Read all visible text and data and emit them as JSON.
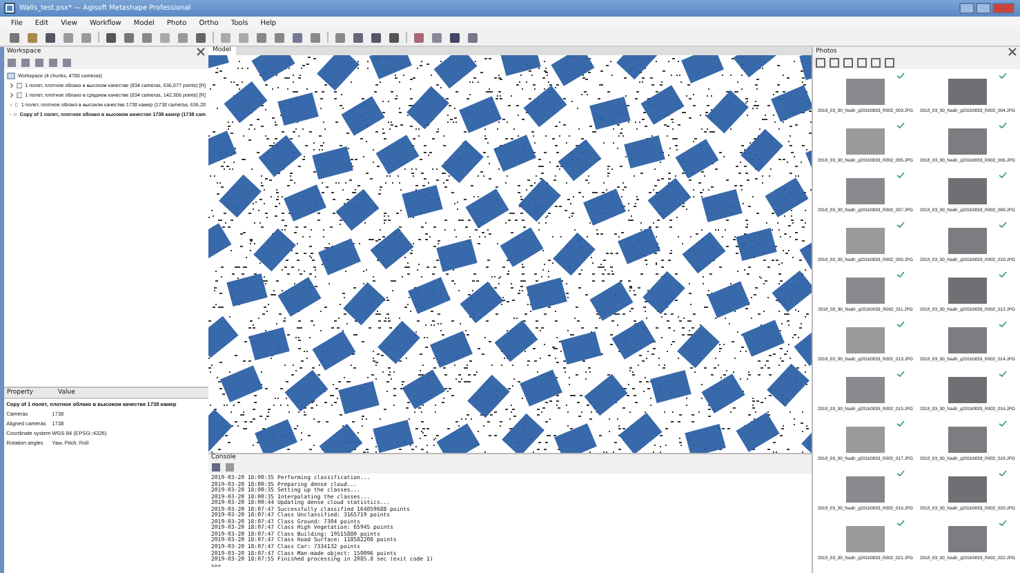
{
  "window": {
    "title": "Walls_test.psx* — Agisoft Metashape Professional"
  },
  "menu": [
    "File",
    "Edit",
    "View",
    "Workflow",
    "Model",
    "Photo",
    "Ortho",
    "Tools",
    "Help"
  ],
  "workspace": {
    "title": "Workspace",
    "root": "Workspace (4 chunks, 4780 cameras)",
    "chunks": [
      {
        "label": "1 полет, плотное облако в высоком качестве (834 cameras, 636,077 points) [R]",
        "active": false
      },
      {
        "label": "1 полет, плотное облако в среднем качестве (834 cameras, 142,306 points) [R]",
        "active": false
      },
      {
        "label": "1 полет, плотное облако в высоком качестве 1738 камер (1738 cameras, 636,28",
        "active": false
      },
      {
        "label": "Copy of 1 полет, плотное облако в высоком качестве 1738 камер (1738 cam",
        "active": true
      }
    ]
  },
  "properties": {
    "columns": [
      "Property",
      "Value"
    ],
    "heading": "Copy of 1 полет, плотное облако в высоком качестве 1738 камер",
    "rows": [
      [
        "Cameras",
        "1738"
      ],
      [
        "Aligned cameras",
        "1738"
      ],
      [
        "Coordinate system",
        "WGS 84 (EPSG::4326)"
      ],
      [
        "Rotation angles",
        "Yaw, Pitch, Roll"
      ]
    ]
  },
  "model": {
    "title": "Model"
  },
  "console": {
    "title": "Console",
    "lines": [
      "2019-03-20 18:00:35 Performing classification...",
      "2019-03-20 18:00:35 Preparing dense cloud...",
      "2019-03-20 18:00:35 Setting up the classes...",
      "2019-03-20 18:00:35 Interpolating the classes...",
      "2019-03-20 18:00:44 Updating dense cloud statistics...",
      "2019-03-20 18:07:47 Successfully classified 164859688 points",
      "2019-03-20 18:07:47 Class Unclassified: 3165719 points",
      "2019-03-20 18:07:47 Class Ground: 7304 points",
      "2019-03-20 18:07:47 Class High Vegetation: 65945 points",
      "2019-03-20 18:07:47 Class Building: 19515880 points",
      "2019-03-20 18:07:47 Class Road Surface: 118582208 points",
      "2019-03-20 18:07:47 Class Car: 7334132 points",
      "2019-03-20 18:07:47 Class Man-made object: 150096 points",
      "2019-03-20 18:07:55 Finished processing in 2085.8 sec (exit code 1)"
    ],
    "prompt": ">>>"
  },
  "photos": {
    "title": "Photos",
    "items": [
      {
        "name": "2018_03_30_Nadir_g201b0033_R002_003.JPG"
      },
      {
        "name": "2018_03_30_Nadir_g201b0033_R002_004.JPG"
      },
      {
        "name": "2018_03_30_Nadir_g201b0033_R002_005.JPG"
      },
      {
        "name": "2018_03_30_Nadir_g201b0033_R002_006.JPG"
      },
      {
        "name": "2018_03_30_Nadir_g201b0033_R002_007.JPG"
      },
      {
        "name": "2018_03_30_Nadir_g201b0033_R002_008.JPG"
      },
      {
        "name": "2018_03_30_Nadir_g201b0033_R002_009.JPG"
      },
      {
        "name": "2018_03_30_Nadir_g201b0033_R002_010.JPG"
      },
      {
        "name": "2018_03_30_Nadir_g201b0033_R002_011.JPG"
      },
      {
        "name": "2018_03_30_Nadir_g201b0033_R002_012.JPG"
      },
      {
        "name": "2018_03_30_Nadir_g201b0033_R002_013.JPG"
      },
      {
        "name": "2018_03_30_Nadir_g201b0033_R002_014.JPG"
      },
      {
        "name": "2018_03_30_Nadir_g201b0033_R002_015.JPG"
      },
      {
        "name": "2018_03_30_Nadir_g201b0033_R002_016.JPG"
      },
      {
        "name": "2018_03_30_Nadir_g201b0033_R002_017.JPG"
      },
      {
        "name": "2018_03_30_Nadir_g201b0033_R002_018.JPG"
      },
      {
        "name": "2018_03_30_Nadir_g201b0033_R002_019.JPG"
      },
      {
        "name": "2018_03_30_Nadir_g201b0033_R002_020.JPG"
      },
      {
        "name": "2018_03_30_Nadir_g201b0033_R002_021.JPG"
      },
      {
        "name": "2018_03_30_Nadir_g201b0033_R002_022.JPG"
      }
    ]
  }
}
